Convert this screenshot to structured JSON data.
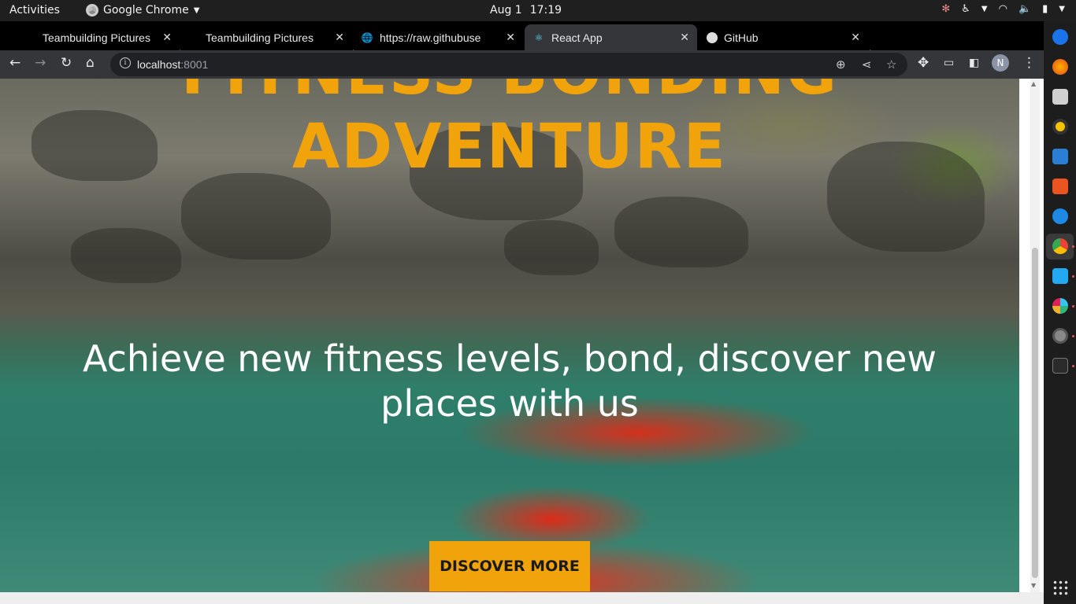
{
  "system_bar": {
    "activities": "Activities",
    "app_name": "Google Chrome",
    "date": "Aug 1",
    "time": "17:19"
  },
  "tabs": [
    {
      "title": "Teambuilding Pictures",
      "active": false
    },
    {
      "title": "Teambuilding Pictures",
      "active": false
    },
    {
      "title": "https://raw.githubuse",
      "active": false
    },
    {
      "title": "React App",
      "active": true
    },
    {
      "title": "GitHub",
      "active": false
    }
  ],
  "address_bar": {
    "host": "localhost",
    "port": ":8001"
  },
  "profile": {
    "initial": "N"
  },
  "hero": {
    "title_line1": "FITNESS BONDING",
    "title_line2": "ADVENTURE",
    "subtitle": "Achieve new fitness levels, bond, discover new places with us",
    "cta_label": "DISCOVER MORE"
  },
  "colors": {
    "accent": "#f0a30a",
    "tab_strip": "#000000",
    "toolbar": "#35363a"
  },
  "dock_icons": [
    "chrome-icon",
    "firefox-icon",
    "files-icon",
    "rhythmbox-icon",
    "writer-icon",
    "software-icon",
    "help-icon",
    "chrome-active-icon",
    "vscode-icon",
    "slack-icon",
    "settings-icon",
    "terminal-icon",
    "apps-grid-icon"
  ]
}
